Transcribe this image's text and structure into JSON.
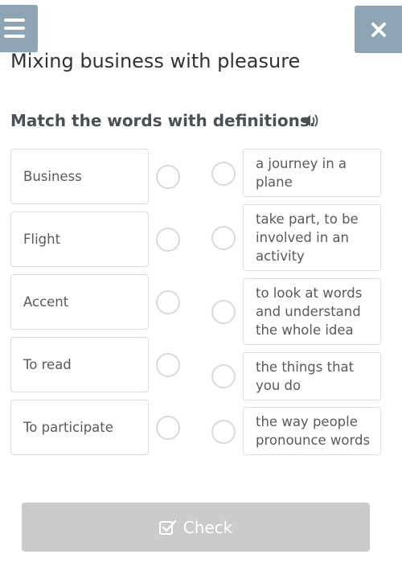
{
  "header": {
    "menu_icon": "hamburger-menu-icon",
    "close_icon": "close-x-icon",
    "title": "Mixing business with pleasure"
  },
  "exercise": {
    "instruction": "Match the words with definitions.",
    "audio_icon": "speaker-icon",
    "words": [
      "Business",
      "Flight",
      "Accent",
      "To read",
      "To participate"
    ],
    "definitions": [
      [
        "a journey in a",
        "plane"
      ],
      [
        "take part, to be",
        "involved in an",
        "activity"
      ],
      [
        "to look at words",
        "and understand",
        "the whole idea"
      ],
      [
        "the things that",
        "you do"
      ],
      [
        "the way people",
        "pronounce words"
      ]
    ]
  },
  "footer": {
    "check_label": "Check",
    "check_icon": "checkbox-icon"
  },
  "colors": {
    "toolbar_button": "#8da4b4",
    "disabled_button": "#cbcbcb",
    "card_border": "#d9dde0"
  }
}
